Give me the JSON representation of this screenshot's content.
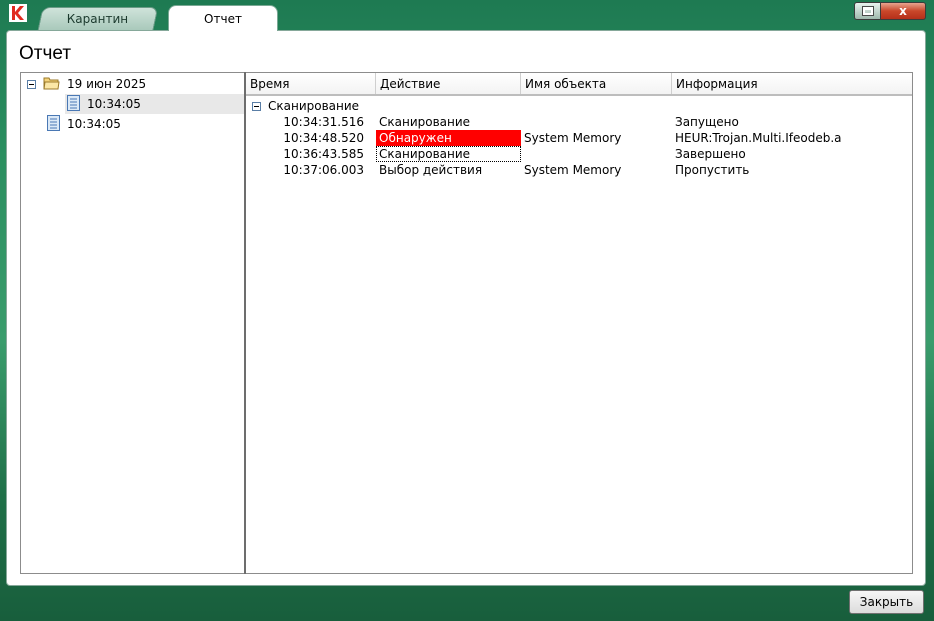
{
  "app": {
    "brand_color": "#e02a1f"
  },
  "tabs": [
    {
      "label": "Карантин",
      "active": false
    },
    {
      "label": "Отчет",
      "active": true
    }
  ],
  "window_controls": {
    "close_glyph": "x"
  },
  "page_title": "Отчет",
  "tree": {
    "nodes": [
      {
        "label": "19 июн 2025",
        "icon": "folder-open-icon",
        "expanded": true,
        "level": 0
      },
      {
        "label": "10:34:05",
        "icon": "document-icon",
        "selected": true,
        "level": 1
      },
      {
        "label": "10:34:05",
        "icon": "document-icon",
        "selected": false,
        "level": 0
      }
    ]
  },
  "list": {
    "columns": [
      "Время",
      "Действие",
      "Имя объекта",
      "Информация"
    ],
    "group": {
      "label": "Сканирование",
      "expanded": true
    },
    "rows": [
      {
        "time": "10:34:31.516",
        "action": "Сканирование",
        "object": "",
        "info": "Запущено",
        "status": "normal"
      },
      {
        "time": "10:34:48.520",
        "action": "Обнаружен",
        "object": "System Memory",
        "info": "HEUR:Trojan.Multi.Ifeodeb.a",
        "status": "detected"
      },
      {
        "time": "10:36:43.585",
        "action": "Сканирование",
        "object": "",
        "info": "Завершено",
        "status": "focused"
      },
      {
        "time": "10:37:06.003",
        "action": "Выбор действия",
        "object": "System Memory",
        "info": "Пропустить",
        "status": "normal"
      }
    ],
    "detected_color": "#ff0000"
  },
  "footer": {
    "close_label": "Закрыть"
  }
}
